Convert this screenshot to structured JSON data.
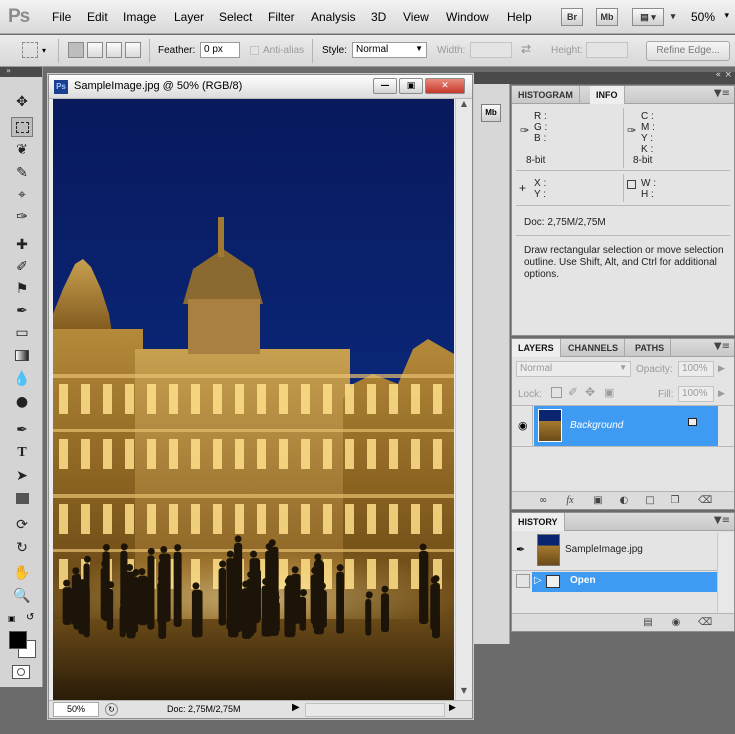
{
  "app": {
    "logo": "Ps",
    "menus": [
      "File",
      "Edit",
      "Image",
      "Layer",
      "Select",
      "Filter",
      "Analysis",
      "3D",
      "View",
      "Window",
      "Help"
    ],
    "bridge_label": "Br",
    "minibridge_label": "Mb",
    "zoom": "50%"
  },
  "options": {
    "feather_label": "Feather:",
    "feather_value": "0 px",
    "antialias_label": "Anti-alias",
    "style_label": "Style:",
    "style_value": "Normal",
    "width_label": "Width:",
    "height_label": "Height:",
    "refine_edge": "Refine Edge..."
  },
  "document": {
    "title": "SampleImage.jpg @ 50% (RGB/8)",
    "zoom": "50%",
    "doc_size": "Doc: 2,75M/2,75M"
  },
  "info_panel": {
    "tabs": [
      "HISTOGRAM",
      "INFO"
    ],
    "rgb_labels": [
      "R :",
      "G :",
      "B :"
    ],
    "cmyk_labels": [
      "C :",
      "M :",
      "Y :",
      "K :"
    ],
    "bit_depth_left": "8-bit",
    "bit_depth_right": "8-bit",
    "xy_labels": [
      "X :",
      "Y :"
    ],
    "wh_labels": [
      "W :",
      "H :"
    ],
    "doc_size": "Doc: 2,75M/2,75M",
    "hint": "Draw rectangular selection or move selection outline.  Use Shift, Alt, and Ctrl for additional options."
  },
  "layers_panel": {
    "tabs": [
      "LAYERS",
      "CHANNELS",
      "PATHS"
    ],
    "blend_mode": "Normal",
    "opacity_label": "Opacity:",
    "opacity_value": "100%",
    "lock_label": "Lock:",
    "fill_label": "Fill:",
    "fill_value": "100%",
    "layer_name": "Background"
  },
  "history_panel": {
    "tab": "HISTORY",
    "snapshot": "SampleImage.jpg",
    "step": "Open"
  },
  "colors": {
    "selection_blue": "#3f9af2",
    "sky": "#0a1f6a"
  }
}
